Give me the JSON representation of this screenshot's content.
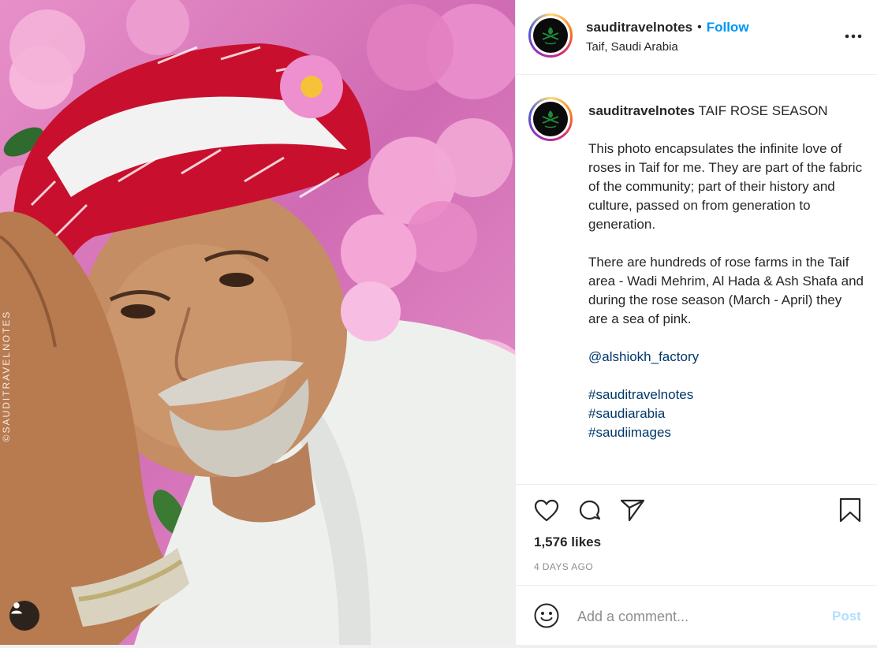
{
  "photo": {
    "watermark": "©SAUDITRAVELNOTES",
    "user_tag_icon": "person-icon"
  },
  "header": {
    "username": "sauditravelnotes",
    "separator": "•",
    "follow_label": "Follow",
    "location": "Taif, Saudi Arabia",
    "more_icon": "more-horizontal-icon"
  },
  "caption": {
    "username": "sauditravelnotes",
    "title": "TAIF ROSE SEASON",
    "paragraph1": "This photo encapsulates the infinite love of roses in Taif for me. They are part of the fabric of the community; part of their history and culture, passed on from generation to generation.",
    "paragraph2": "There are hundreds of rose farms in the Taif area - Wadi Mehrim, Al Hada & Ash Shafa and during the rose season (March - April) they are a sea of pink.",
    "mention": "@alshiokh_factory",
    "hashtags": [
      "#sauditravelnotes",
      "#saudiarabia",
      "#saudiimages"
    ]
  },
  "actions": {
    "like_icon": "heart-icon",
    "comment_icon": "comment-icon",
    "share_icon": "send-icon",
    "save_icon": "bookmark-icon",
    "likes": "1,576 likes",
    "date": "4 DAYS AGO"
  },
  "comment": {
    "emoji_icon": "emoji-icon",
    "placeholder": "Add a comment...",
    "post_label": "Post"
  },
  "colors": {
    "accent": "#0095f6",
    "link": "#00376b",
    "post_disabled": "#b2dffc",
    "border": "#efefef"
  }
}
